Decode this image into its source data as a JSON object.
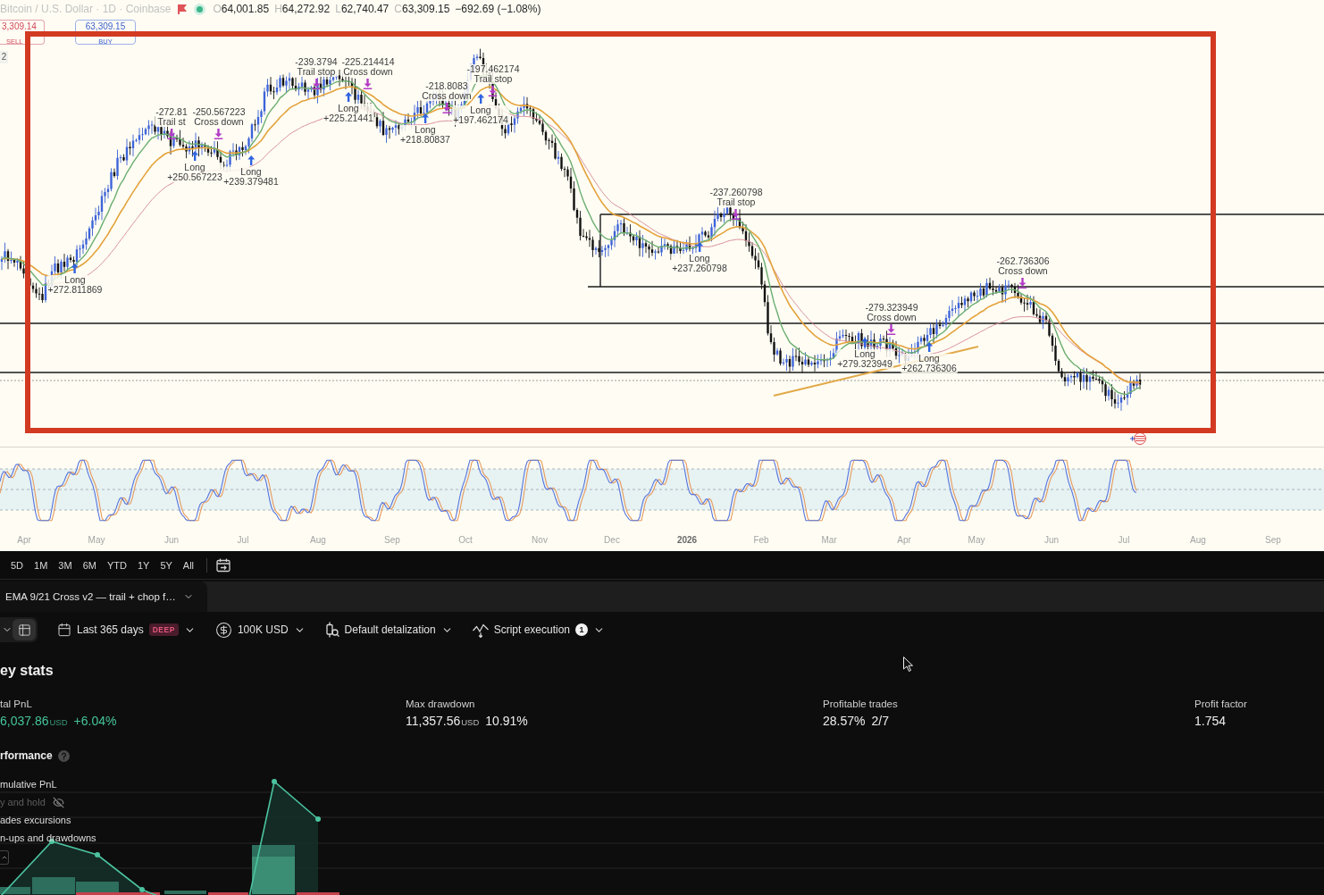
{
  "chart": {
    "symbol": "Bitcoin / U.S. Dollar · 1D · Coinbase",
    "ohlc": [
      {
        "key": "O",
        "value": "64,001.85"
      },
      {
        "key": "H",
        "value": "64,272.92"
      },
      {
        "key": "L",
        "value": "62,740.47"
      },
      {
        "key": "C",
        "value": "63,309.15"
      }
    ],
    "change": "−692.69 (−1.08%)",
    "order_buttons": [
      {
        "kind": "sell",
        "price": "3,309.14",
        "label": "SELL"
      },
      {
        "kind": "buy",
        "price": "63,309.15",
        "label": "BUY"
      }
    ],
    "pane_number": "2",
    "trade_labels": [
      {
        "kind": "exit",
        "lines": [
          "-239.3794",
          "Trail stop"
        ]
      },
      {
        "kind": "exit",
        "lines": [
          "-225.214414",
          "Cross down"
        ]
      },
      {
        "kind": "exit",
        "lines": [
          "-197.462174",
          "Trail stop"
        ]
      },
      {
        "kind": "exit",
        "lines": [
          "-218.8083",
          "Cross down"
        ]
      },
      {
        "kind": "exit",
        "lines": [
          "-272.81",
          "Trail st"
        ]
      },
      {
        "kind": "exit",
        "lines": [
          "-250.567223",
          "Cross down"
        ]
      },
      {
        "kind": "entry",
        "lines": [
          "Long",
          "+225.21441"
        ]
      },
      {
        "kind": "entry",
        "lines": [
          "Long",
          "+197.462174"
        ]
      },
      {
        "kind": "entry",
        "lines": [
          "Long",
          "+218.80837"
        ]
      },
      {
        "kind": "entry",
        "lines": [
          "Long",
          "+250.567223"
        ]
      },
      {
        "kind": "entry",
        "lines": [
          "Long",
          "+239.379481"
        ]
      },
      {
        "kind": "exit",
        "lines": [
          "-237.260798",
          "Trail stop"
        ]
      },
      {
        "kind": "entry",
        "lines": [
          "Long",
          "+237.260798"
        ]
      },
      {
        "kind": "exit",
        "lines": [
          "-262.736306",
          "Cross down"
        ]
      },
      {
        "kind": "entry",
        "lines": [
          "Long",
          "+272.811869"
        ]
      },
      {
        "kind": "exit",
        "lines": [
          "-279.323949",
          "Cross down"
        ]
      },
      {
        "kind": "entry",
        "lines": [
          "Long",
          "+279.323949"
        ]
      },
      {
        "kind": "entry",
        "lines": [
          "Long",
          "+262.736306"
        ]
      }
    ]
  },
  "time_axis": [
    {
      "label": "Apr",
      "kind": "month"
    },
    {
      "label": "May",
      "kind": "month"
    },
    {
      "label": "Jun",
      "kind": "month"
    },
    {
      "label": "Jul",
      "kind": "month"
    },
    {
      "label": "Aug",
      "kind": "month"
    },
    {
      "label": "Sep",
      "kind": "month"
    },
    {
      "label": "Oct",
      "kind": "month"
    },
    {
      "label": "Nov",
      "kind": "month"
    },
    {
      "label": "Dec",
      "kind": "month"
    },
    {
      "label": "2026",
      "kind": "year"
    },
    {
      "label": "Feb",
      "kind": "month"
    },
    {
      "label": "Mar",
      "kind": "month"
    },
    {
      "label": "Apr",
      "kind": "month"
    },
    {
      "label": "May",
      "kind": "month"
    },
    {
      "label": "Jun",
      "kind": "month"
    },
    {
      "label": "Jul",
      "kind": "month"
    },
    {
      "label": "Aug",
      "kind": "month"
    },
    {
      "label": "Sep",
      "kind": "month"
    }
  ],
  "timeframes": [
    "5D",
    "1M",
    "3M",
    "6M",
    "YTD",
    "1Y",
    "5Y",
    "All"
  ],
  "strategy_tabs": [
    {
      "label": "EMA 9/21 Cross v2 — trail + chop f…",
      "selected": true
    }
  ],
  "view_switch": [
    {
      "kind": "menu",
      "selected": false
    },
    {
      "kind": "table",
      "selected": true
    }
  ],
  "toolbar": [
    {
      "kind": "date_range",
      "label": "Last 365 days",
      "badge": "DEEP"
    },
    {
      "kind": "capital",
      "label": "100K USD"
    },
    {
      "kind": "detalization",
      "label": "Default detalization"
    },
    {
      "kind": "script",
      "label": "Script execution",
      "count": "1"
    }
  ],
  "key_stats": {
    "title": "ey stats",
    "items": [
      {
        "label": "tal PnL",
        "value": "6,037.86",
        "unit": "USD",
        "extra": "+6.04%",
        "kind": "gain"
      },
      {
        "label": "Max drawdown",
        "value": "11,357.56",
        "unit": "USD",
        "extra": "10.91%",
        "kind": "plain"
      },
      {
        "label": "Profitable trades",
        "value": "28.57%",
        "extra": "2/7",
        "kind": "plain"
      },
      {
        "label": "Profit factor",
        "value": "1.754",
        "kind": "plain"
      }
    ]
  },
  "performance": {
    "title": "rformance",
    "legend": [
      {
        "label": "mulative PnL",
        "hidden": false
      },
      {
        "label": "y and hold",
        "hidden": true
      },
      {
        "label": "ades excursions",
        "hidden": false
      },
      {
        "label": "n-ups and drawdowns",
        "hidden": false
      }
    ]
  }
}
